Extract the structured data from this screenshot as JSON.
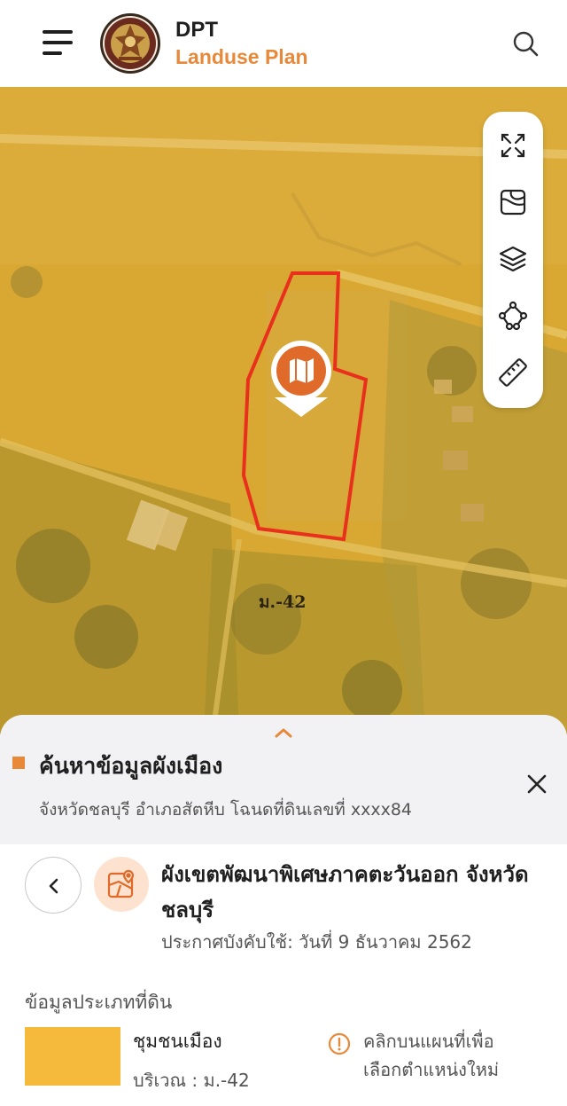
{
  "header": {
    "brand_top": "DPT",
    "brand_sub": "Landuse Plan",
    "accent_color": "#e8893a"
  },
  "map": {
    "zone_label": "ม.-42",
    "parcel_outline_color": "#e8301c",
    "pin_color": "#e06a2a",
    "tools": [
      "fullscreen-icon",
      "basemap-icon",
      "layers-icon",
      "polygon-draw-icon",
      "ruler-icon"
    ]
  },
  "search": {
    "title": "ค้นหาข้อมูลผังเมือง",
    "subtitle": "จังหวัดชลบุรี อำเภอสัตหีบ โฉนดที่ดินเลขที่ xxxx84"
  },
  "plan": {
    "title": "ผังเขตพัฒนาพิเศษภาคตะวันออก จังหวัดชลบุรี",
    "date": "ประกาศบังคับใช้: วันที่ 9 ธันวาคม 2562"
  },
  "landuse": {
    "section_label": "ข้อมูลประเภทที่ดิน",
    "swatch_color": "#f5b93b",
    "type": "ชุมชนเมือง",
    "zone": "บริเวณ : ม.-42",
    "hint_line1": "คลิกบนแผนที่เพื่อ",
    "hint_line2": "เลือกตำแหน่งใหม่"
  }
}
